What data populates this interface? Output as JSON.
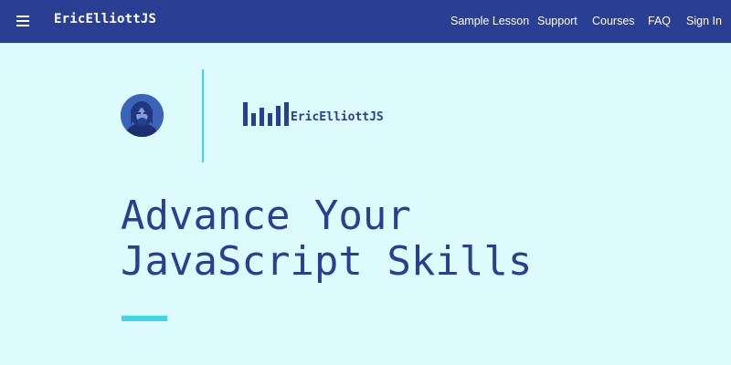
{
  "header": {
    "brand": "EricElliottJS",
    "nav": [
      {
        "label": "Sample Lesson"
      },
      {
        "label": "Support"
      },
      {
        "label": "Courses"
      },
      {
        "label": "FAQ"
      },
      {
        "label": "Sign In"
      }
    ],
    "menu_icon": "hamburger-menu-icon"
  },
  "hero": {
    "logo_text": "EricElliottJS",
    "title_line1": "Advance Your",
    "title_line2": "JavaScript Skills"
  },
  "colors": {
    "nav_background": "#2a3f93",
    "page_background": "#ddfbfd",
    "accent": "#3fd5ea",
    "primary_text": "#2a3f93"
  }
}
